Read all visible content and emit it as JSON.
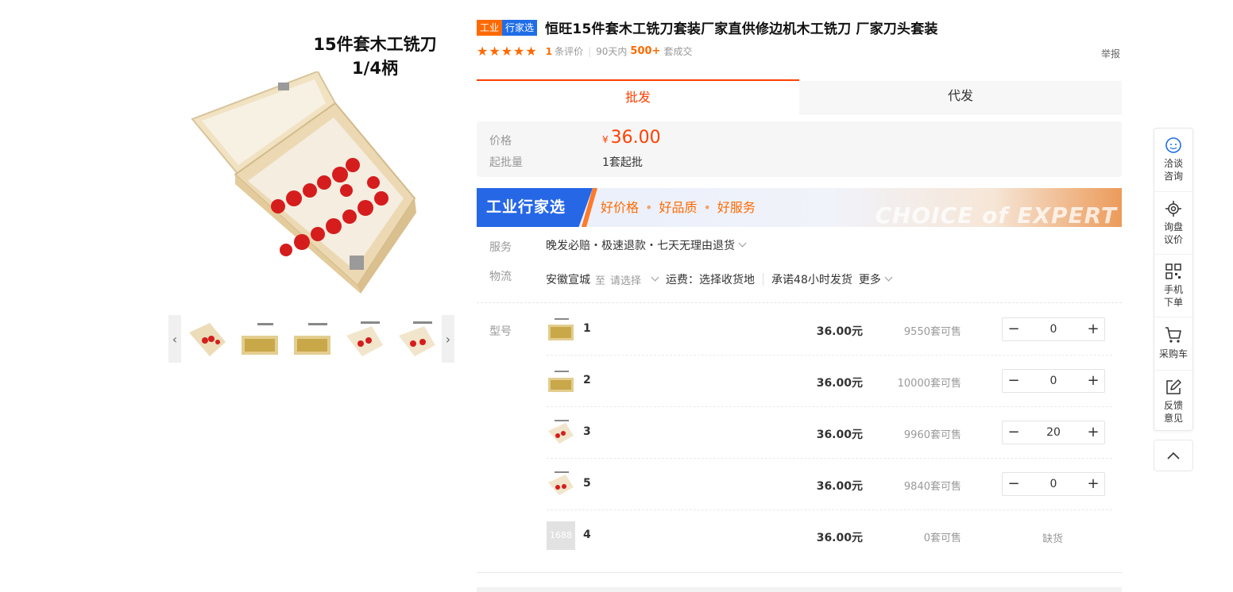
{
  "gallery": {
    "main_caption_line1": "15件套木工铣刀",
    "main_caption_line2": "1/4柄",
    "prev_glyph": "‹",
    "next_glyph": "›"
  },
  "product": {
    "badge_left": "工业",
    "badge_right": "行家选",
    "title": "恒旺15件套木工铣刀套装厂家直供修边机木工铣刀 厂家刀头套装",
    "rating_stars": 5,
    "review_count": "1",
    "review_suffix": "条评价",
    "period": "90天内",
    "sold_count": "500+",
    "sold_suffix": "套成交",
    "report": "举报"
  },
  "tabs": {
    "wholesale": "批发",
    "dropship": "代发"
  },
  "price_box": {
    "price_label": "价格",
    "currency": "¥",
    "price": "36.00",
    "moq_label": "起批量",
    "moq": "1套起批"
  },
  "banner": {
    "logo_text": "工业行家选",
    "slogan1": "好价格",
    "slogan2": "好品质",
    "slogan3": "好服务",
    "dot": "•",
    "watermark": "CHOICE of EXPERT"
  },
  "service": {
    "label": "服务",
    "value": "晚发必赔・极速退款・七天无理由退货"
  },
  "logistics": {
    "label": "物流",
    "origin": "安徽宣城",
    "to": "至",
    "select": "请选择",
    "shipping": "运费：选择收货地",
    "promise": "承诺48小时发货",
    "more": "更多"
  },
  "sku": {
    "label": "型号",
    "rows": [
      {
        "name": "1",
        "price": "36.00元",
        "stock": "9550套可售",
        "qty": "0"
      },
      {
        "name": "2",
        "price": "36.00元",
        "stock": "10000套可售",
        "qty": "0"
      },
      {
        "name": "3",
        "price": "36.00元",
        "stock": "9960套可售",
        "qty": "20"
      },
      {
        "name": "5",
        "price": "36.00元",
        "stock": "9840套可售",
        "qty": "0"
      },
      {
        "name": "4",
        "price": "36.00元",
        "stock": "0套可售",
        "status": "缺货",
        "placeholder": "1688"
      }
    ],
    "minus": "−",
    "plus": "+"
  },
  "toolbar": {
    "chat": "洽谈咨询",
    "inquiry": "询盘议价",
    "mobile": "手机下单",
    "cart": "采购车",
    "feedback": "反馈意见"
  },
  "colors": {
    "accent": "#ff4000",
    "badge_orange": "#ff6a00",
    "badge_blue": "#1f6de8"
  }
}
